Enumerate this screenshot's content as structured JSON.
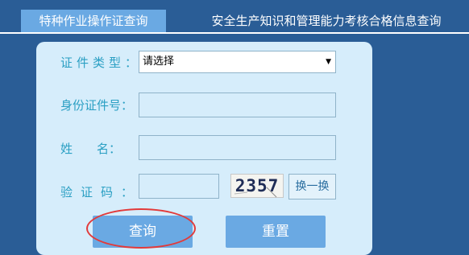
{
  "nav": {
    "tabs": [
      {
        "label": "特种作业操作证查询",
        "active": true
      },
      {
        "label": "安全生产知识和管理能力考核合格信息查询",
        "active": false
      }
    ]
  },
  "form": {
    "cert_type_label": "证件类型：",
    "cert_type_selected": "请选择",
    "id_label": "身份证件号：",
    "id_value": "",
    "name_label": "姓　　名：",
    "name_value": "",
    "captcha_label": "验证码：",
    "captcha_value": "",
    "captcha_image_text": "2357",
    "refresh_label": "换一换"
  },
  "actions": {
    "query_label": "查询",
    "reset_label": "重置"
  },
  "colors": {
    "page_bg": "#2a5d96",
    "panel_bg": "#d6edfb",
    "accent": "#6aa9e3",
    "label_text": "#2a9fc3",
    "highlight_ring": "#e23a3a"
  }
}
